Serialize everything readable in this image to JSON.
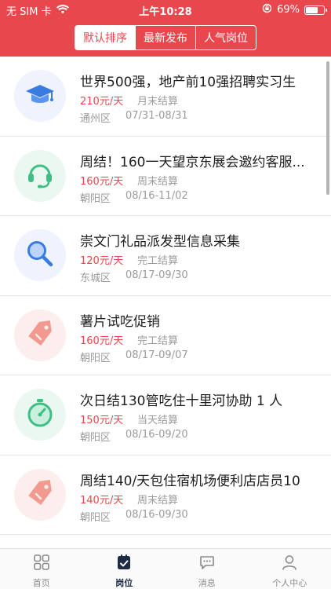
{
  "status_bar": {
    "carrier": "无 SIM 卡",
    "time": "上午10:28",
    "battery": "69%",
    "battery_level": 0.69
  },
  "tabs": [
    {
      "label": "默认排序",
      "active": true
    },
    {
      "label": "最新发布",
      "active": false
    },
    {
      "label": "人气岗位",
      "active": false
    }
  ],
  "jobs": [
    {
      "title": "世界500强，地产前10强招聘实习生",
      "salary": "210元/天",
      "settle": "月末结算",
      "district": "通州区",
      "dates": "07/31-08/31",
      "icon": "graduation-cap-icon",
      "bg": "#eef3fd"
    },
    {
      "title": "周结！160一天望京东展会邀约客服...",
      "salary": "160元/天",
      "settle": "周末结算",
      "district": "朝阳区",
      "dates": "08/16-11/02",
      "icon": "headset-icon",
      "bg": "#eaf8f1"
    },
    {
      "title": "崇文门礼品派发型信息采集",
      "salary": "120元/天",
      "settle": "完工结算",
      "district": "东城区",
      "dates": "08/17-09/30",
      "icon": "magnifier-icon",
      "bg": "#eef3fd"
    },
    {
      "title": "薯片试吃促销",
      "salary": "160元/天",
      "settle": "完工结算",
      "district": "朝阳区",
      "dates": "08/17-09/07",
      "icon": "price-tag-icon",
      "bg": "#fdeeee"
    },
    {
      "title": "次日结130管吃住十里河协助 1 人",
      "salary": "150元/天",
      "settle": "当天结算",
      "district": "朝阳区",
      "dates": "08/16-09/20",
      "icon": "stopwatch-icon",
      "bg": "#eaf8f1"
    },
    {
      "title": "周结140/天包住宿机场便利店店员10",
      "salary": "140元/天",
      "settle": "周末结算",
      "district": "朝阳区",
      "dates": "08/16-09/30",
      "icon": "price-tag-icon",
      "bg": "#fdeeee"
    }
  ],
  "tab_bar": [
    {
      "label": "首页",
      "icon": "grid-icon",
      "active": false
    },
    {
      "label": "岗位",
      "icon": "clipboard-check-icon",
      "active": true
    },
    {
      "label": "消息",
      "icon": "chat-bubble-icon",
      "active": false
    },
    {
      "label": "个人中心",
      "icon": "person-icon",
      "active": false
    }
  ]
}
